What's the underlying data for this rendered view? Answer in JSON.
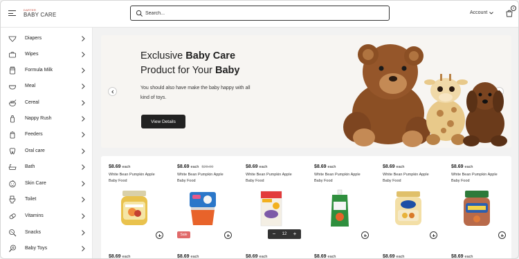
{
  "header": {
    "logo_top": "DARTER",
    "logo_main": "BABY CARE",
    "search_placeholder": "Search...",
    "account_label": "Account",
    "cart_count": "0"
  },
  "sidebar": {
    "items": [
      {
        "label": "Diapers",
        "icon": "diaper-icon"
      },
      {
        "label": "Wipes",
        "icon": "wipes-icon"
      },
      {
        "label": "Formula Milk",
        "icon": "formula-milk-icon"
      },
      {
        "label": "Meal",
        "icon": "meal-bowl-icon"
      },
      {
        "label": "Cereal",
        "icon": "cereal-bowl-icon"
      },
      {
        "label": "Nappy Rush",
        "icon": "bottle-icon"
      },
      {
        "label": "Feeders",
        "icon": "feeder-icon"
      },
      {
        "label": "Oral care",
        "icon": "tooth-icon"
      },
      {
        "label": "Bath",
        "icon": "bathtub-icon"
      },
      {
        "label": "Skin Care",
        "icon": "baby-face-icon"
      },
      {
        "label": "Toilet",
        "icon": "toilet-icon"
      },
      {
        "label": "Vitamins",
        "icon": "vitamins-icon"
      },
      {
        "label": "Snacks",
        "icon": "snacks-icon"
      },
      {
        "label": "Baby Toys",
        "icon": "rattle-icon"
      }
    ]
  },
  "hero": {
    "title_line1_pre": "Exclusive ",
    "title_line1_bold": "Baby Care",
    "title_line2_pre": "Product for Your ",
    "title_line2_bold": "Baby",
    "subtitle": "You should also have make the baby happy with all kind of toys.",
    "button_label": "View Details"
  },
  "products": {
    "items": [
      {
        "price": "$8.69",
        "each": "each",
        "old_price": "",
        "name": "White Bean Pumpkin Apple Baby Food",
        "sale": "",
        "image": "jar-yellow"
      },
      {
        "price": "$8.69",
        "each": "each",
        "old_price": "$29.00",
        "name": "White Bean Pumpkin Apple Baby Food",
        "sale": "Sale",
        "image": "tub-orange"
      },
      {
        "price": "$8.69",
        "each": "each",
        "old_price": "",
        "name": "White Bean Pumpkin Apple Baby Food",
        "sale": "",
        "image": "cereal-box",
        "quantity": "12"
      },
      {
        "price": "$8.69",
        "each": "each",
        "old_price": "",
        "name": "White Bean Pumpkin Apple Baby Food",
        "sale": "",
        "image": "pouch-green"
      },
      {
        "price": "$8.69",
        "each": "each",
        "old_price": "",
        "name": "White Bean Pumpkin Apple Baby Food",
        "sale": "",
        "image": "jar-hero"
      },
      {
        "price": "$8.69",
        "each": "each",
        "old_price": "",
        "name": "White Bean Pumpkin Apple Baby Food",
        "sale": "",
        "image": "jar-green-lid"
      }
    ],
    "next_row_prices": [
      "$8.69",
      "$8.69",
      "$8.69",
      "$8.69",
      "$8.69",
      "$8.69"
    ]
  },
  "colors": {
    "primary_dark": "#222222",
    "sale_badge": "#e06a6a",
    "background": "#f2f2f2"
  }
}
